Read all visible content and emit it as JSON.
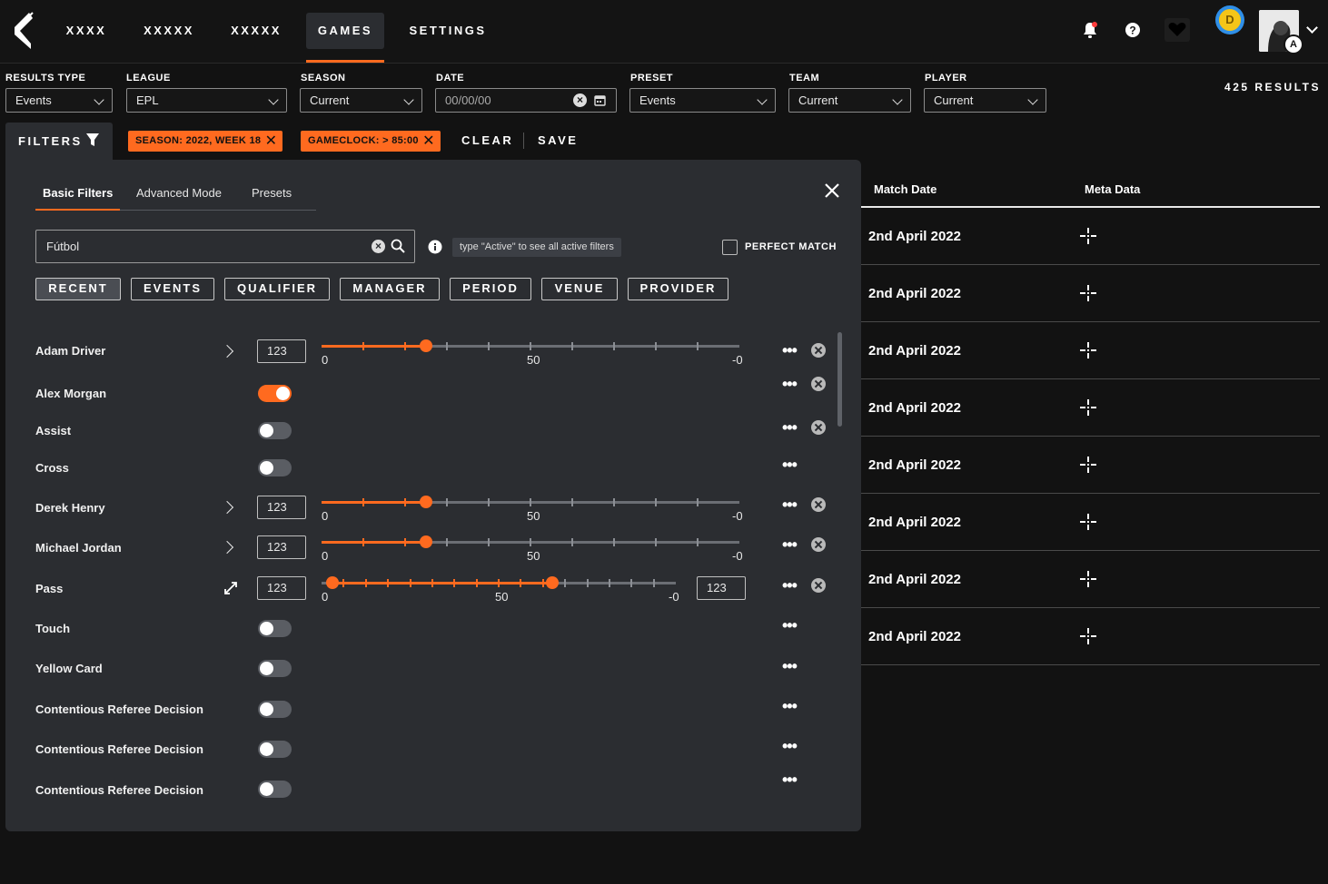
{
  "nav": {
    "items": [
      {
        "label": "XXXX"
      },
      {
        "label": "XXXXX"
      },
      {
        "label": "XXXXX"
      },
      {
        "label": "GAMES"
      },
      {
        "label": "SETTINGS"
      }
    ],
    "active": "GAMES",
    "avatar_badge": "D",
    "profile_badge": "A",
    "icons": [
      "notification-bell-icon",
      "help-icon",
      "heart-icon",
      "coin-icon",
      "avatar",
      "chevron-down-icon"
    ]
  },
  "filter_bar": {
    "results_type": {
      "label": "RESULTS TYPE",
      "value": "Events"
    },
    "league": {
      "label": "LEAGUE",
      "value": "EPL"
    },
    "season": {
      "label": "SEASON",
      "value": "Current"
    },
    "date": {
      "label": "DATE",
      "value": "00/00/00"
    },
    "preset": {
      "label": "PRESET",
      "value": "Events"
    },
    "team": {
      "label": "TEAM",
      "value": "Current"
    },
    "player": {
      "label": "PLAYER",
      "value": "Current"
    },
    "results_count": "425 RESULTS"
  },
  "filters_row": {
    "filters_label": "FILTERS",
    "chips": [
      "SEASON: 2022, WEEK 18",
      "GAMECLOCK: > 85:00"
    ],
    "clear_label": "CLEAR",
    "save_label": "SAVE"
  },
  "panel": {
    "tabs": [
      "Basic Filters",
      "Advanced Mode",
      "Presets"
    ],
    "active_tab": "Basic Filters",
    "search_value": "Fútbol",
    "hint": "type \"Active\" to see all active filters",
    "perfect_match_label": "PERFECT MATCH",
    "perfect_match_checked": false,
    "categories": [
      "RECENT",
      "EVENTS",
      "QUALIFIER",
      "MANAGER",
      "PERIOD",
      "VENUE",
      "PROVIDER"
    ],
    "active_category": "RECENT",
    "rows": [
      {
        "label": "Adam Driver",
        "type": "slider",
        "input": "123",
        "slider_value": 0.25,
        "min_label": "0",
        "mid_label": "50",
        "max_label": "-0"
      },
      {
        "label": "Alex Morgan",
        "type": "toggle",
        "on": true
      },
      {
        "label": "Assist",
        "type": "toggle",
        "on": false
      },
      {
        "label": "Cross",
        "type": "toggle",
        "on": false
      },
      {
        "label": "Derek Henry",
        "type": "slider",
        "input": "123",
        "slider_value": 0.25,
        "min_label": "0",
        "mid_label": "50",
        "max_label": "-0"
      },
      {
        "label": "Michael Jordan",
        "type": "slider",
        "input": "123",
        "slider_value": 0.25,
        "min_label": "0",
        "mid_label": "50",
        "max_label": "-0"
      },
      {
        "label": "Pass",
        "type": "range",
        "input_min": "123",
        "input_max": "123",
        "range_low": 0.03,
        "range_high": 0.65,
        "min_label": "0",
        "mid_label": "50",
        "max_label": "-0"
      },
      {
        "label": "Touch",
        "type": "toggle",
        "on": false
      },
      {
        "label": "Yellow Card",
        "type": "toggle",
        "on": false
      },
      {
        "label": "Contentious Referee Decision",
        "type": "toggle",
        "on": false
      },
      {
        "label": "Contentious Referee Decision",
        "type": "toggle",
        "on": false
      },
      {
        "label": "Contentious Referee Decision",
        "type": "toggle",
        "on": false
      }
    ]
  },
  "table": {
    "headers": [
      "Match Date",
      "Meta Data"
    ],
    "rows": [
      {
        "date": "2nd April 2022"
      },
      {
        "date": "2nd April 2022"
      },
      {
        "date": "2nd April 2022"
      },
      {
        "date": "2nd April 2022"
      },
      {
        "date": "2nd April 2022"
      },
      {
        "date": "2nd April 2022"
      },
      {
        "date": "2nd April 2022"
      },
      {
        "date": "2nd April 2022"
      }
    ]
  },
  "colors": {
    "accent": "#ff6a1f",
    "panel": "#2b2d31",
    "background": "#121212"
  }
}
